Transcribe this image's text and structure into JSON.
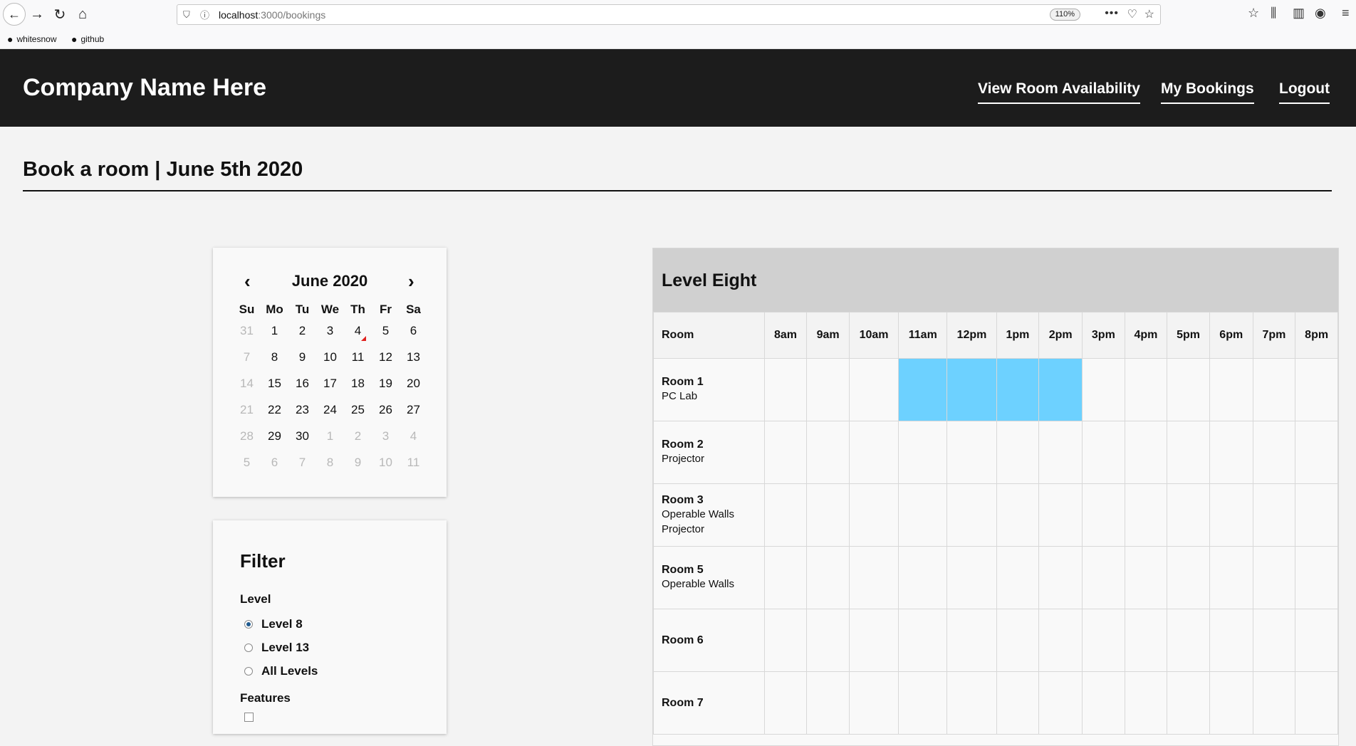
{
  "browser": {
    "url_host": "localhost",
    "url_path": ":3000/bookings",
    "zoom": "110%",
    "bookmarks": [
      "whitesnow",
      "github"
    ]
  },
  "header": {
    "brand": "Company Name Here",
    "nav": [
      "View Room Availability",
      "My Bookings",
      "Logout"
    ]
  },
  "page_title": "Book a room | June 5th 2020",
  "calendar": {
    "month_label": "June 2020",
    "prev": "‹",
    "next": "›",
    "weekdays": [
      "Su",
      "Mo",
      "Tu",
      "We",
      "Th",
      "Fr",
      "Sa"
    ],
    "weeks": [
      [
        {
          "d": "31",
          "muted": true
        },
        {
          "d": "1"
        },
        {
          "d": "2"
        },
        {
          "d": "3"
        },
        {
          "d": "4",
          "marker": true
        },
        {
          "d": "5"
        },
        {
          "d": "6"
        }
      ],
      [
        {
          "d": "7",
          "muted": true
        },
        {
          "d": "8"
        },
        {
          "d": "9"
        },
        {
          "d": "10"
        },
        {
          "d": "11"
        },
        {
          "d": "12"
        },
        {
          "d": "13"
        }
      ],
      [
        {
          "d": "14",
          "muted": true
        },
        {
          "d": "15"
        },
        {
          "d": "16"
        },
        {
          "d": "17"
        },
        {
          "d": "18"
        },
        {
          "d": "19"
        },
        {
          "d": "20"
        }
      ],
      [
        {
          "d": "21",
          "muted": true
        },
        {
          "d": "22"
        },
        {
          "d": "23"
        },
        {
          "d": "24"
        },
        {
          "d": "25"
        },
        {
          "d": "26"
        },
        {
          "d": "27"
        }
      ],
      [
        {
          "d": "28",
          "muted": true
        },
        {
          "d": "29"
        },
        {
          "d": "30"
        },
        {
          "d": "1",
          "muted": true
        },
        {
          "d": "2",
          "muted": true
        },
        {
          "d": "3",
          "muted": true
        },
        {
          "d": "4",
          "muted": true
        }
      ],
      [
        {
          "d": "5",
          "muted": true
        },
        {
          "d": "6",
          "muted": true
        },
        {
          "d": "7",
          "muted": true
        },
        {
          "d": "8",
          "muted": true
        },
        {
          "d": "9",
          "muted": true
        },
        {
          "d": "10",
          "muted": true
        },
        {
          "d": "11",
          "muted": true
        }
      ]
    ]
  },
  "filter": {
    "title": "Filter",
    "level_label": "Level",
    "level_options": [
      {
        "label": "Level 8",
        "selected": true
      },
      {
        "label": "Level 13",
        "selected": false
      },
      {
        "label": "All Levels",
        "selected": false
      }
    ],
    "features_label": "Features"
  },
  "schedule": {
    "title": "Level Eight",
    "room_header": "Room",
    "hours": [
      "8am",
      "9am",
      "10am",
      "11am",
      "12pm",
      "1pm",
      "2pm",
      "3pm",
      "4pm",
      "5pm",
      "6pm",
      "7pm",
      "8pm"
    ],
    "booked_color": "#6dd1ff",
    "rooms": [
      {
        "name": "Room 1",
        "features": [
          "PC Lab"
        ],
        "booked": [
          "11am",
          "12pm",
          "1pm",
          "2pm"
        ]
      },
      {
        "name": "Room 2",
        "features": [
          "Projector"
        ],
        "booked": []
      },
      {
        "name": "Room 3",
        "features": [
          "Operable Walls",
          "Projector"
        ],
        "booked": []
      },
      {
        "name": "Room 5",
        "features": [
          "Operable Walls"
        ],
        "booked": []
      },
      {
        "name": "Room 6",
        "features": [],
        "booked": []
      },
      {
        "name": "Room 7",
        "features": [],
        "booked": []
      }
    ]
  }
}
